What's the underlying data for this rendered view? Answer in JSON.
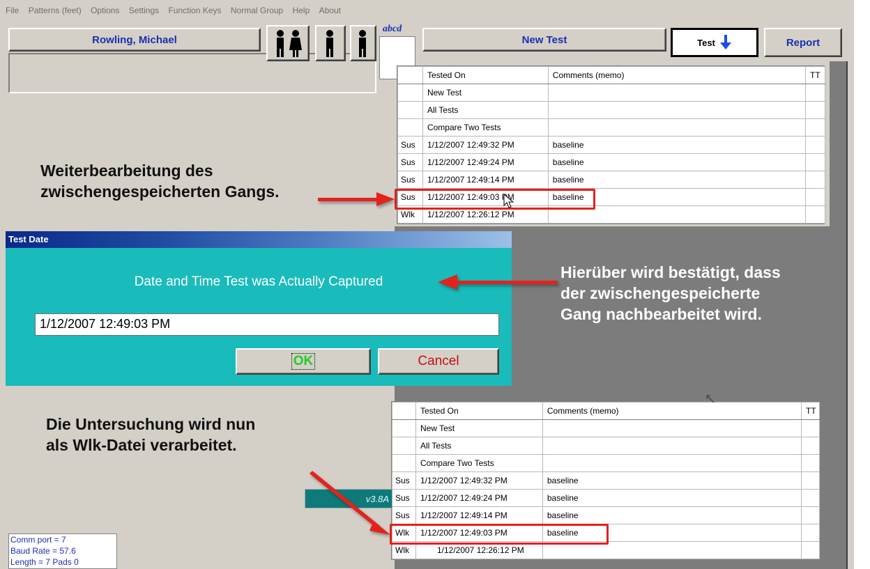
{
  "menu": [
    "File",
    "Patterns (feet)",
    "Options",
    "Settings",
    "Function Keys",
    "Normal Group",
    "Help",
    "About"
  ],
  "patient": {
    "name": "Rowling, Michael"
  },
  "toolbar": {
    "abcd_label": "abcd",
    "new_test_label": "New Test",
    "test_label": "Test",
    "report_label": "Report"
  },
  "grid_top": {
    "headers": [
      "",
      "Tested On",
      "Comments (memo)",
      "TT"
    ],
    "rows": [
      [
        "",
        "New Test",
        "",
        ""
      ],
      [
        "",
        "All Tests",
        "",
        ""
      ],
      [
        "",
        "Compare Two Tests",
        "",
        ""
      ],
      [
        "Sus",
        "1/12/2007 12:49:32 PM",
        "baseline",
        ""
      ],
      [
        "Sus",
        "1/12/2007 12:49:24 PM",
        "baseline",
        ""
      ],
      [
        "Sus",
        "1/12/2007 12:49:14 PM",
        "baseline",
        ""
      ],
      [
        "Sus",
        "1/12/2007 12:49:03 PM",
        "baseline",
        ""
      ],
      [
        "Wlk",
        "1/12/2007 12:26:12 PM",
        "",
        ""
      ]
    ]
  },
  "grid_bottom": {
    "headers": [
      "",
      "Tested On",
      "Comments (memo)",
      "TT"
    ],
    "rows": [
      [
        "",
        "New Test",
        "",
        ""
      ],
      [
        "",
        "All Tests",
        "",
        ""
      ],
      [
        "",
        "Compare Two Tests",
        "",
        ""
      ],
      [
        "Sus",
        "1/12/2007 12:49:32 PM",
        "baseline",
        ""
      ],
      [
        "Sus",
        "1/12/2007 12:49:24 PM",
        "baseline",
        ""
      ],
      [
        "Sus",
        "1/12/2007 12:49:14 PM",
        "baseline",
        ""
      ],
      [
        "Wlk",
        "1/12/2007 12:49:03 PM",
        "baseline",
        ""
      ],
      [
        "Wlk",
        "1/12/2007 12:26:12 PM",
        "",
        ""
      ]
    ]
  },
  "dialog": {
    "title": "Test Date",
    "message": "Date and Time Test was Actually Captured",
    "input_value": "1/12/2007 12:49:03 PM",
    "ok_label": "OK",
    "cancel_label": "Cancel"
  },
  "version_label": "v3.8A",
  "status_box": [
    "Comm port = 7",
    "Baud Rate = 57.6",
    "Length = 7 Pads  0"
  ],
  "annotations": {
    "top_left": [
      "Weiterbearbeitung des",
      "zwischengespeicherten Gangs."
    ],
    "right": [
      "Hierüber wird bestätigt, dass",
      "der zwischengespeicherte",
      "Gang nachbearbeitet wird."
    ],
    "bottom_left": [
      "Die Untersuchung wird nun",
      "als Wlk-Datei verarbeitet."
    ]
  },
  "colors": {
    "accent_red": "#e4201c",
    "dialog_teal": "#1abbbb",
    "button_text_blue": "#1a2fb0",
    "ok_green": "#22cc22",
    "cancel_red": "#c01010"
  }
}
